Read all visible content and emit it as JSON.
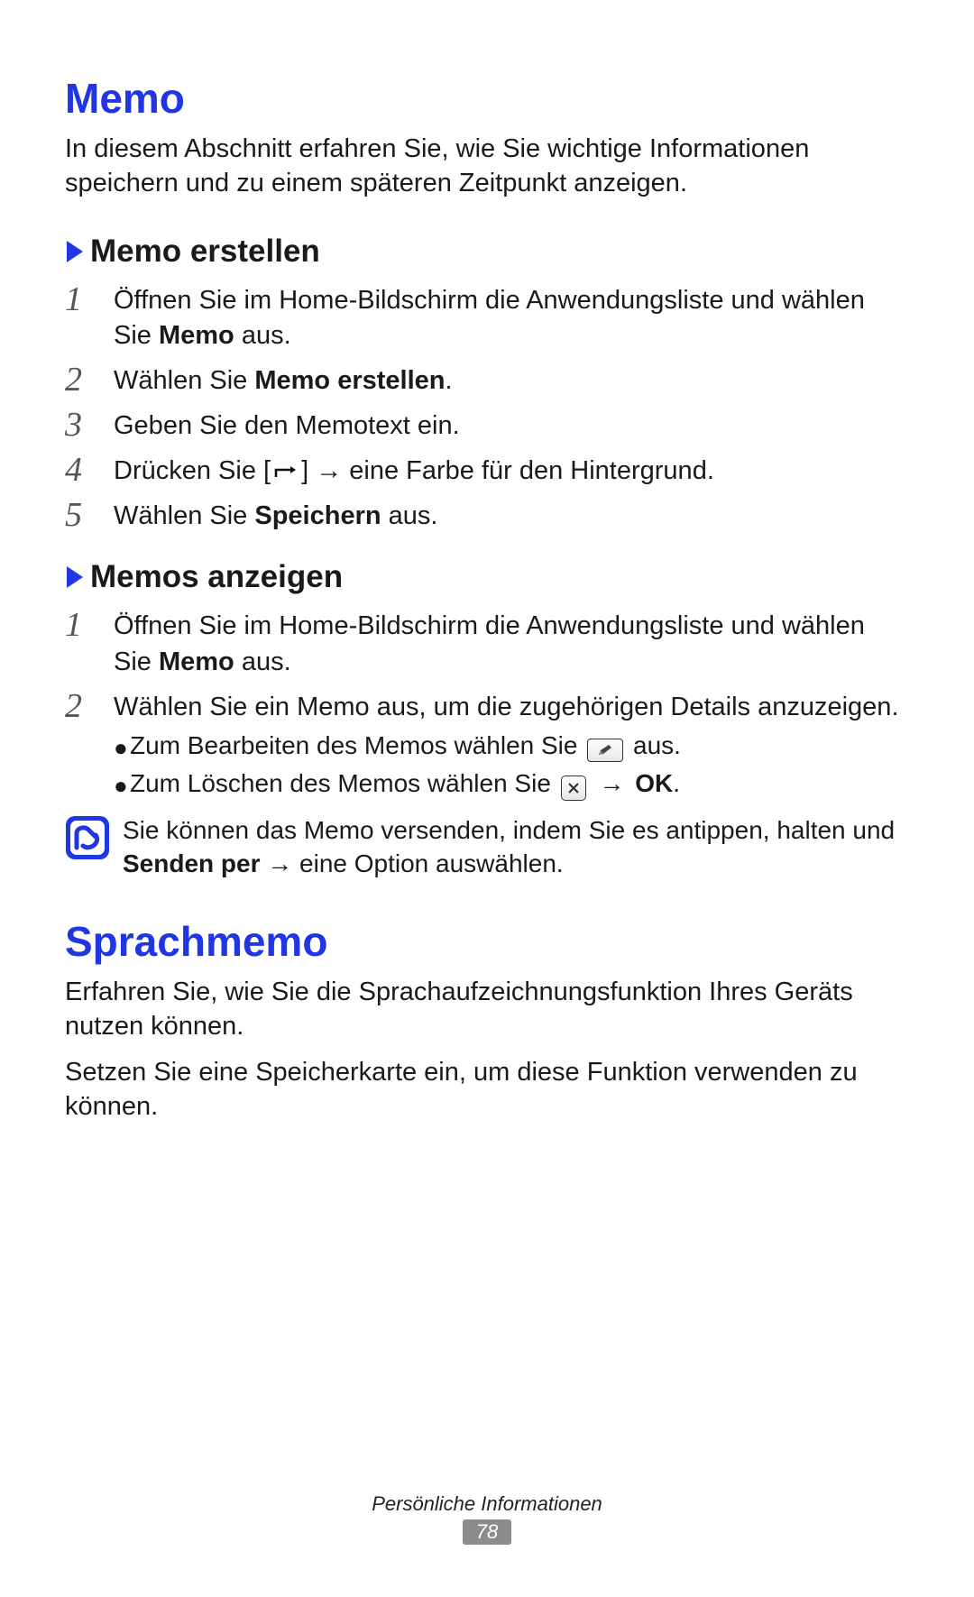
{
  "section1": {
    "title": "Memo",
    "intro": "In diesem Abschnitt erfahren Sie, wie Sie wichtige Informationen speichern und zu einem späteren Zeitpunkt anzeigen.",
    "sub1": {
      "title": "Memo erstellen",
      "steps": {
        "s1a": "Öffnen Sie im Home-Bildschirm die Anwendungsliste und wählen Sie ",
        "s1b": "Memo",
        "s1c": " aus.",
        "s2a": "Wählen Sie ",
        "s2b": "Memo erstellen",
        "s2c": ".",
        "s3": "Geben Sie den Memotext ein.",
        "s4a": "Drücken Sie [",
        "s4b": "] → eine Farbe für den Hintergrund.",
        "s5a": "Wählen Sie ",
        "s5b": "Speichern",
        "s5c": " aus."
      }
    },
    "sub2": {
      "title": "Memos anzeigen",
      "steps": {
        "s1a": "Öffnen Sie im Home-Bildschirm die Anwendungsliste und wählen Sie ",
        "s1b": "Memo",
        "s1c": " aus.",
        "s2": "Wählen Sie ein Memo aus, um die zugehörigen Details anzuzeigen.",
        "b1a": "Zum Bearbeiten des Memos wählen Sie ",
        "b1b": " aus.",
        "b2a": "Zum Löschen des Memos wählen Sie ",
        "b2b": " → ",
        "b2c": "OK",
        "b2d": "."
      },
      "note": {
        "a": "Sie können das Memo versenden, indem Sie es antippen, halten und ",
        "b": "Senden per",
        "c": " → eine Option auswählen."
      }
    }
  },
  "section2": {
    "title": "Sprachmemo",
    "p1": "Erfahren Sie, wie Sie die Sprachaufzeichnungsfunktion Ihres Geräts nutzen können.",
    "p2": "Setzen Sie eine Speicherkarte ein, um diese Funktion verwenden zu können."
  },
  "nums": {
    "n1": "1",
    "n2": "2",
    "n3": "3",
    "n4": "4",
    "n5": "5"
  },
  "footer": {
    "chapter": "Persönliche Informationen",
    "page": "78"
  }
}
